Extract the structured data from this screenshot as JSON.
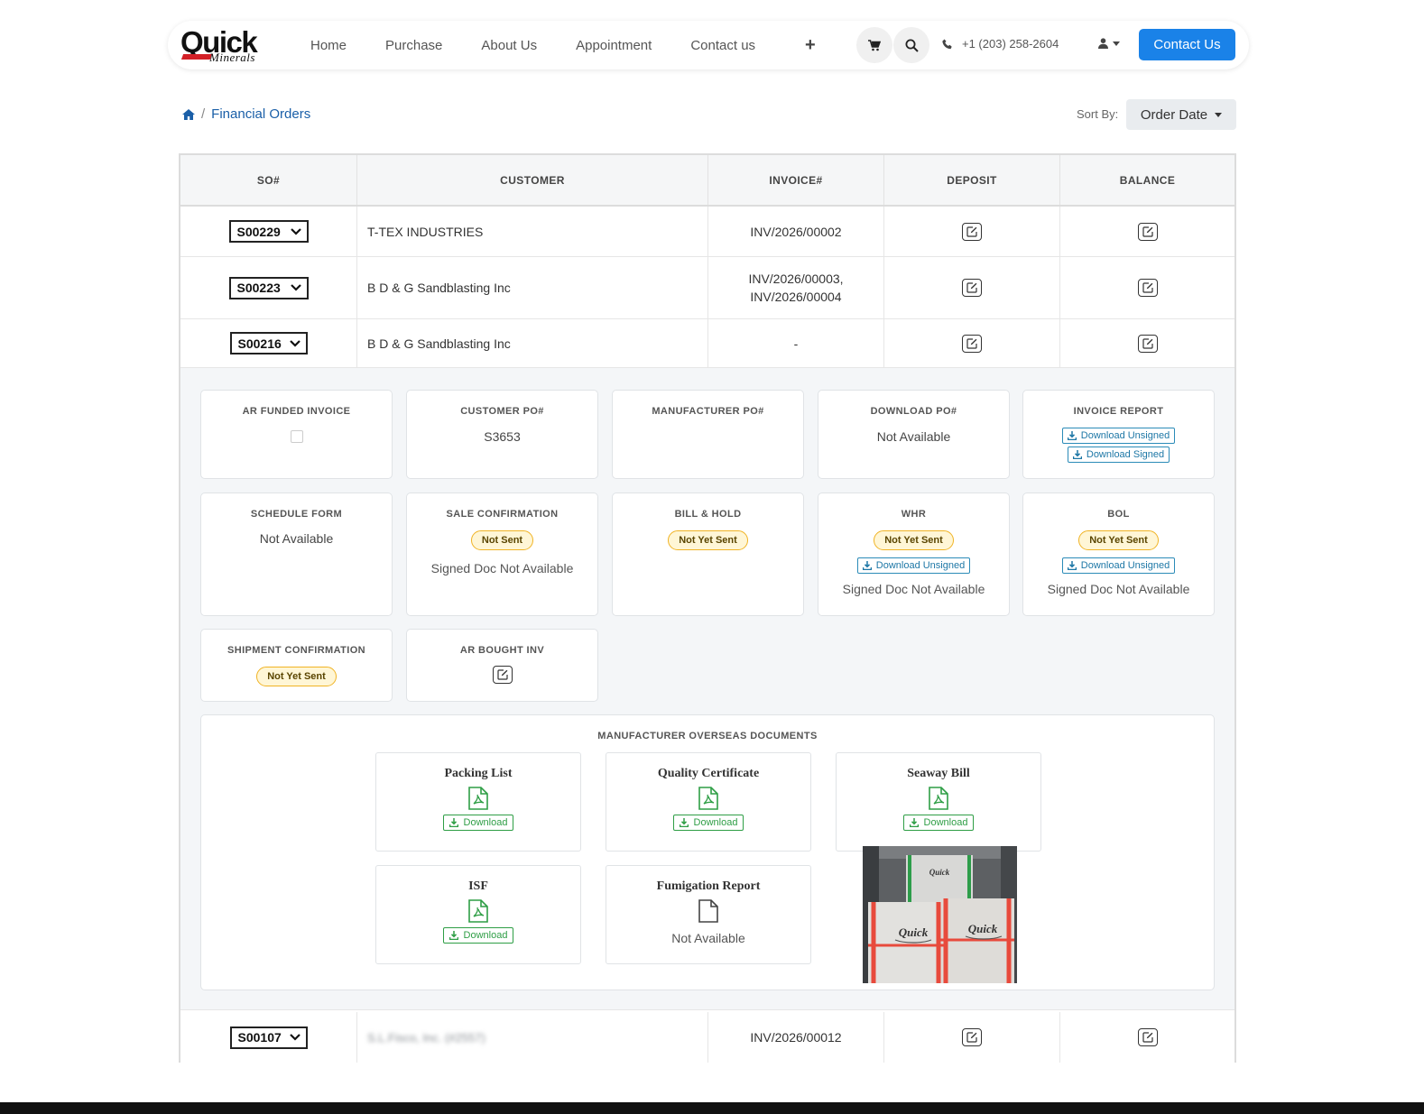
{
  "brand": {
    "logo_main": "Quick",
    "logo_sub": "Minerals",
    "accent": "#1a82e8",
    "logo_red": "#d32027"
  },
  "nav": {
    "links": [
      "Home",
      "Purchase",
      "About Us",
      "Appointment",
      "Contact us"
    ],
    "phone": "+1 (203) 258-2604",
    "contact_btn": "Contact Us"
  },
  "breadcrumb": {
    "current": "Financial Orders"
  },
  "sort": {
    "label": "Sort By:",
    "value": "Order Date"
  },
  "table": {
    "headers": [
      "SO#",
      "CUSTOMER",
      "INVOICE#",
      "DEPOSIT",
      "BALANCE"
    ],
    "rows": [
      {
        "so": "S00229",
        "customer": "T-TEX INDUSTRIES",
        "invoice": [
          "INV/2026/00002"
        ]
      },
      {
        "so": "S00223",
        "customer": "B D & G Sandblasting Inc",
        "invoice": [
          "INV/2026/00003,",
          "INV/2026/00004"
        ]
      },
      {
        "so": "S00216",
        "customer": "B D & G Sandblasting Inc",
        "invoice": [
          "-"
        ]
      },
      {
        "so": "S00107",
        "customer": "S.L.Fisco, Inc. (#2557)",
        "invoice": [
          "INV/2026/00012"
        ]
      }
    ]
  },
  "detail": {
    "ar_funded": {
      "title": "AR FUNDED INVOICE"
    },
    "customer_po": {
      "title": "CUSTOMER PO#",
      "value": "S3653"
    },
    "manufacturer_po": {
      "title": "MANUFACTURER PO#"
    },
    "download_po": {
      "title": "DOWNLOAD PO#",
      "value": "Not Available"
    },
    "invoice_report": {
      "title": "INVOICE REPORT",
      "btn_unsigned": "Download Unsigned",
      "btn_signed": "Download Signed"
    },
    "schedule_form": {
      "title": "SCHEDULE FORM",
      "value": "Not Available"
    },
    "sale_confirmation": {
      "title": "SALE CONFIRMATION",
      "badge": "Not Sent",
      "sub": "Signed Doc Not Available"
    },
    "bill_hold": {
      "title": "BILL & HOLD",
      "badge": "Not Yet Sent"
    },
    "whr": {
      "title": "WHR",
      "badge": "Not Yet Sent",
      "btn": "Download Unsigned",
      "sub": "Signed Doc Not Available"
    },
    "bol": {
      "title": "BOL",
      "badge": "Not Yet Sent",
      "btn": "Download Unsigned",
      "sub": "Signed Doc Not Available"
    },
    "shipment_confirmation": {
      "title": "SHIPMENT CONFIRMATION",
      "badge": "Not Yet Sent"
    },
    "ar_bought": {
      "title": "AR BOUGHT INV"
    }
  },
  "overseas": {
    "title": "MANUFACTURER OVERSEAS DOCUMENTS",
    "docs": [
      {
        "name": "Packing List",
        "action": "Download"
      },
      {
        "name": "Quality Certificate",
        "action": "Download"
      },
      {
        "name": "Seaway Bill",
        "action": "Download"
      },
      {
        "name": "ISF",
        "action": "Download"
      },
      {
        "name": "Fumigation Report",
        "status": "Not Available"
      }
    ],
    "photo_bag_label": "Quick"
  }
}
